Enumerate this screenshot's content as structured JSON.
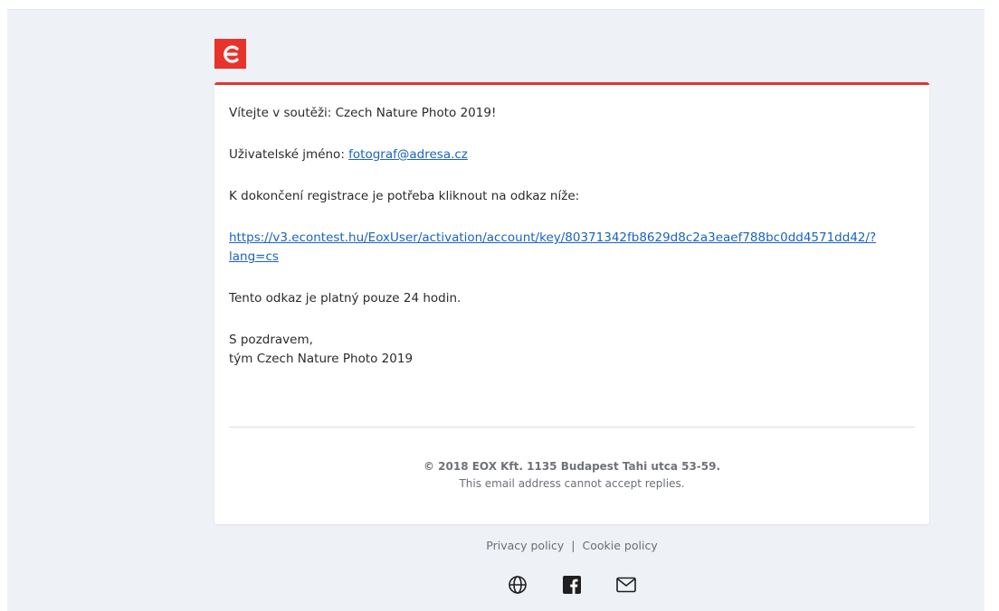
{
  "email": {
    "greeting": "Vítejte v soutěži: Czech Nature Photo 2019!",
    "username_label": "Uživatelské jméno: ",
    "username": "fotograf@adresa.cz",
    "instruction": "K dokončení registrace je potřeba kliknout na odkaz níže:",
    "activation_link_line1": "https://v3.econtest.hu/EoxUser/activation/account/key/80371342fb8629d8c2a3eaef788bc0dd4571dd42/?",
    "activation_link_line2": "lang=cs",
    "validity": "Tento odkaz je platný pouze 24 hodin.",
    "signoff": "S pozdravem,",
    "team": "tým Czech Nature Photo 2019"
  },
  "card_footer": {
    "company": "© 2018 EOX Kft. 1135 Budapest Tahi utca 53-59.",
    "notice": "This email address cannot accept replies."
  },
  "policies": {
    "privacy": "Privacy policy",
    "separator": "|",
    "cookie": "Cookie policy"
  },
  "socials": [
    {
      "icon": "globe-icon"
    },
    {
      "icon": "facebook-icon"
    },
    {
      "icon": "mail-icon"
    }
  ],
  "colors": {
    "brand": "#e8322c",
    "link": "#1a62c4",
    "background": "#eef1f5"
  }
}
